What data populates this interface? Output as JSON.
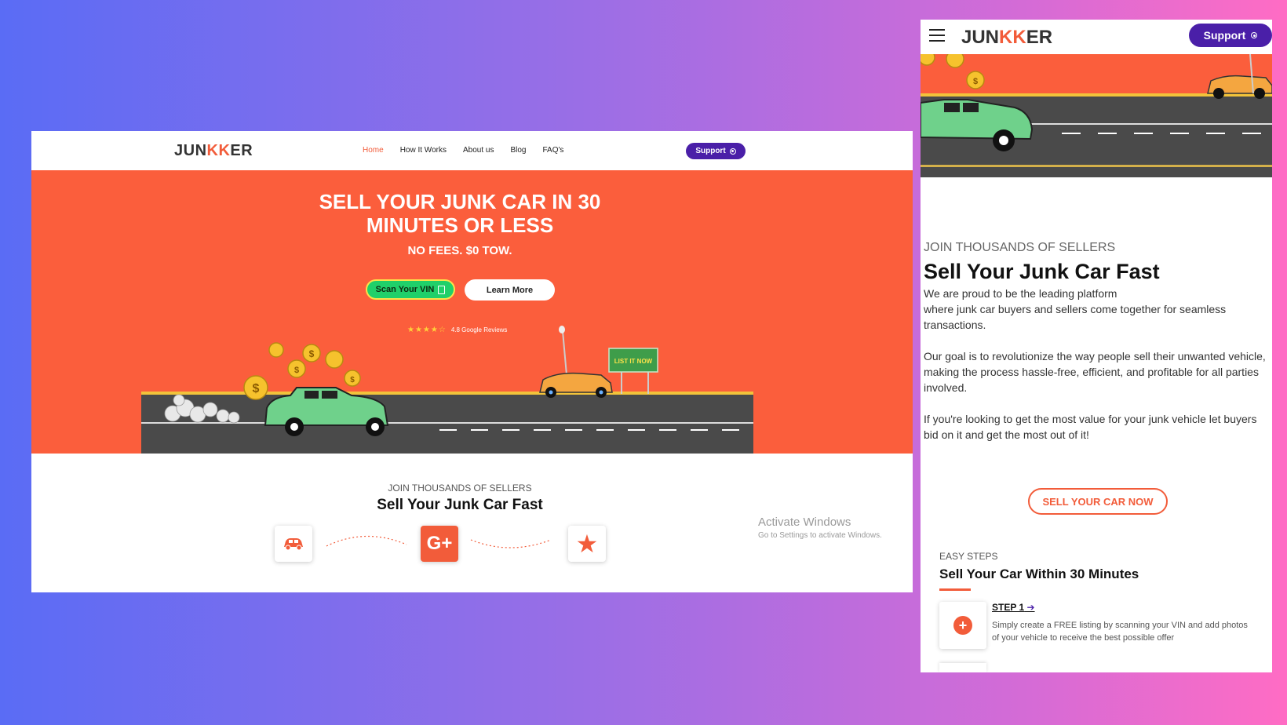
{
  "desktop": {
    "logo": {
      "pre": "JUN",
      "k": "KK",
      "post": "ER"
    },
    "nav": [
      "Home",
      "How It Works",
      "About us",
      "Blog",
      "FAQ's"
    ],
    "support_label": "Support",
    "hero": {
      "title_line1": "SELL YOUR JUNK CAR IN 30",
      "title_line2": "MINUTES OR LESS",
      "subtitle": "NO FEES. $0 TOW.",
      "scan_button": "Scan Your VIN",
      "learn_button": "Learn More",
      "stars": "★★★★☆",
      "reviews": "4.8 Google Reviews",
      "sign": "LIST IT NOW"
    },
    "section_kicker": "JOIN THOUSANDS OF SELLERS",
    "section_title": "Sell Your Junk Car Fast",
    "google_icon_text": "G+",
    "activate_title": "Activate Windows",
    "activate_sub": "Go to Settings to activate Windows."
  },
  "mobile": {
    "logo": {
      "pre": "JUN",
      "k": "KK",
      "post": "ER"
    },
    "support_label": "Support",
    "kicker": "JOIN THOUSANDS OF SELLERS",
    "title": "Sell Your Junk Car Fast",
    "para1a": "We are proud to be the leading platform",
    "para1b": "where junk car buyers and sellers come together for seamless transactions.",
    "para2a": "Our goal is to revolutionize the way people sell their unwanted vehicle,",
    "para2b": "making the process hassle-free, efficient, and profitable for all parties involved.",
    "para3": "If you're looking to get the most value for your junk vehicle let buyers bid on it and get the most out of it!",
    "sell_button": "SELL YOUR CAR NOW",
    "easy_kicker": "EASY STEPS",
    "easy_title": "Sell Your Car Within 30 Minutes",
    "step_title": "STEP 1",
    "step_desc": "Simply create a FREE listing by scanning your VIN and add photos of your vehicle to receive the best possible offer"
  },
  "colors": {
    "accent": "#fb5e3c",
    "purple": "#4a1fa8",
    "green": "#20d06a"
  }
}
